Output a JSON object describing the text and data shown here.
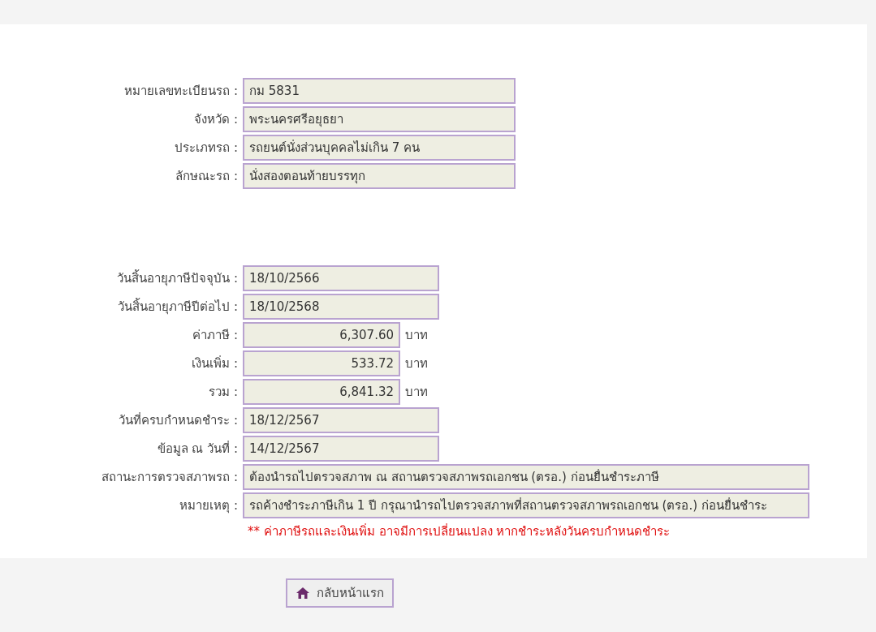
{
  "vehicle_fields": [
    {
      "label": "หมายเลขทะเบียนรถ :",
      "value": "กม 5831"
    },
    {
      "label": "จังหวัด :",
      "value": "พระนครศรีอยุธยา"
    },
    {
      "label": "ประเภทรถ :",
      "value": "รถยนต์นั่งส่วนบุคคลไม่เกิน 7 คน"
    },
    {
      "label": "ลักษณะรถ :",
      "value": "นั่งสองตอนท้ายบรรทุก"
    }
  ],
  "tax_fields": [
    {
      "kind": "date",
      "label": "วันสิ้นอายุภาษีปัจจุบัน :",
      "value": "18/10/2566"
    },
    {
      "kind": "date",
      "label": "วันสิ้นอายุภาษีปีต่อไป :",
      "value": "18/10/2568"
    },
    {
      "kind": "money",
      "label": "ค่าภาษี :",
      "value": "6,307.60",
      "unit": "บาท"
    },
    {
      "kind": "money",
      "label": "เงินเพิ่ม :",
      "value": "533.72",
      "unit": "บาท"
    },
    {
      "kind": "money",
      "label": "รวม :",
      "value": "6,841.32",
      "unit": "บาท"
    },
    {
      "kind": "date",
      "label": "วันที่ครบกำหนดชำระ :",
      "value": "18/12/2567"
    },
    {
      "kind": "date",
      "label": "ข้อมูล ณ วันที่ :",
      "value": "14/12/2567"
    },
    {
      "kind": "long",
      "label": "สถานะการตรวจสภาพรถ :",
      "value": "ต้องนำรถไปตรวจสภาพ ณ สถานตรวจสภาพรถเอกชน (ตรอ.) ก่อนยื่นชำระภาษี"
    },
    {
      "kind": "long",
      "label": "หมายเหตุ :",
      "value": "รถค้างชำระภาษีเกิน 1 ปี กรุณานำรถไปตรวจสภาพที่สถานตรวจสภาพรถเอกชน (ตรอ.) ก่อนยื่นชำระ"
    }
  ],
  "warning_note": "** ค่าภาษีรถและเงินเพิ่ม อาจมีการเปลี่ยนแปลง หากชำระหลังวันครบกำหนดชำระ",
  "home_button": {
    "label": "กลับหน้าแรก"
  }
}
